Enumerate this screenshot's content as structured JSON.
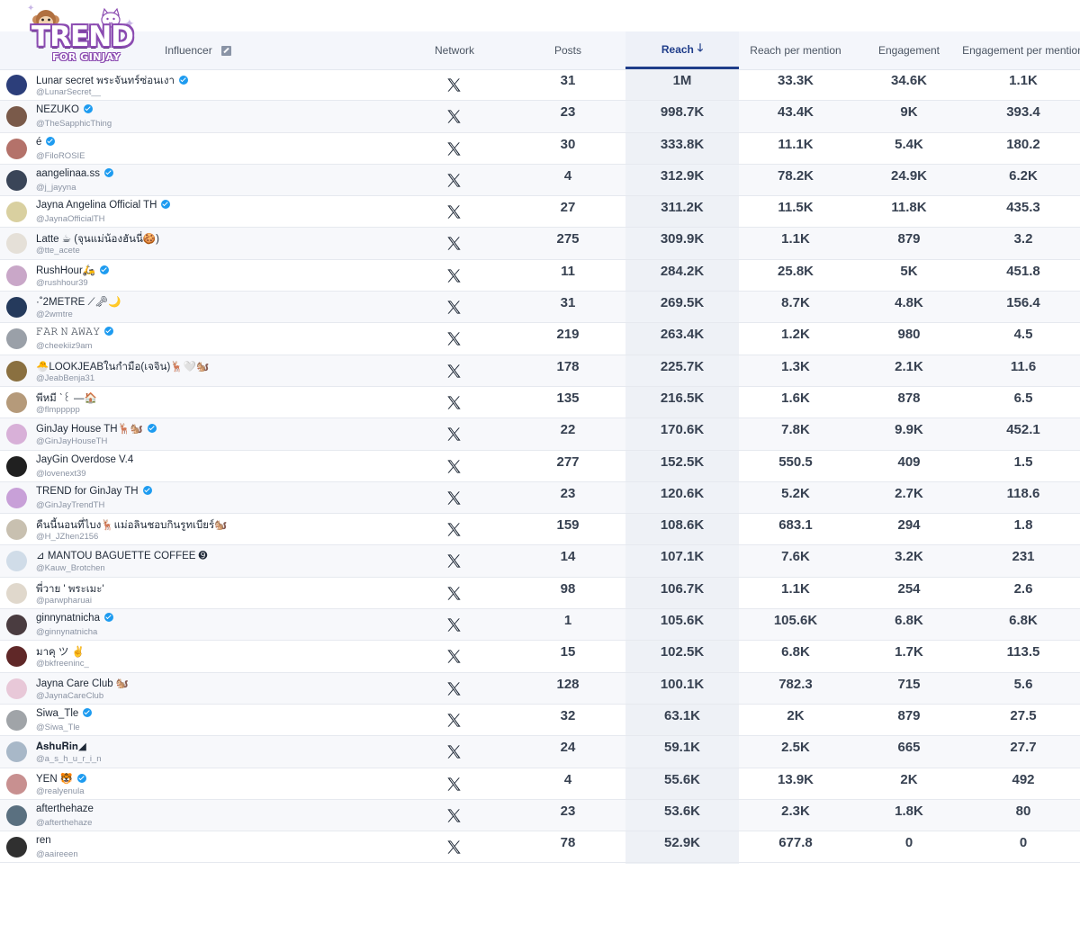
{
  "logo": {
    "word": "TREND",
    "sub": "FOR GINJAY"
  },
  "header": {
    "influencer": "Influencer",
    "network": "Network",
    "posts": "Posts",
    "reach": "Reach",
    "reach_per_mention": "Reach per mention",
    "engagement": "Engagement",
    "engagement_per_mention": "Engagement per mention",
    "sort_icon": "arrow-down-icon",
    "influencer_icon": "external-link-icon"
  },
  "colors": {
    "accent": "#1f3d8a",
    "verified": "#1d9bf0"
  },
  "rows": [
    {
      "name": "Lunar secret พระจันทร์ซ่อนเงา",
      "handle": "@LunarSecret__",
      "verified": true,
      "posts": "31",
      "reach": "1M",
      "rpm": "33.3K",
      "eng": "34.6K",
      "epm": "1.1K",
      "avatar": "#2c3e7a"
    },
    {
      "name": "NEZUKO",
      "handle": "@TheSapphicThing",
      "verified": true,
      "posts": "23",
      "reach": "998.7K",
      "rpm": "43.4K",
      "eng": "9K",
      "epm": "393.4",
      "avatar": "#7a5a4a"
    },
    {
      "name": "é",
      "handle": "@FiloROSIE",
      "verified": true,
      "posts": "30",
      "reach": "333.8K",
      "rpm": "11.1K",
      "eng": "5.4K",
      "epm": "180.2",
      "avatar": "#b4726a"
    },
    {
      "name": "aangelinaa.ss",
      "handle": "@j_jayyna",
      "verified": true,
      "posts": "4",
      "reach": "312.9K",
      "rpm": "78.2K",
      "eng": "24.9K",
      "epm": "6.2K",
      "avatar": "#3a4558"
    },
    {
      "name": "Jayna Angelina Official TH",
      "handle": "@JaynaOfficialTH",
      "verified": true,
      "posts": "27",
      "reach": "311.2K",
      "rpm": "11.5K",
      "eng": "11.8K",
      "epm": "435.3",
      "avatar": "#d9d0a0"
    },
    {
      "name": "Latte ☕ (จุนแม่น้องฮันนี่🍪)",
      "handle": "@tte_acete",
      "verified": false,
      "posts": "275",
      "reach": "309.9K",
      "rpm": "1.1K",
      "eng": "879",
      "epm": "3.2",
      "avatar": "#e5e0d8"
    },
    {
      "name": "RushHour🛵",
      "handle": "@rushhour39",
      "verified": true,
      "posts": "11",
      "reach": "284.2K",
      "rpm": "25.8K",
      "eng": "5K",
      "epm": "451.8",
      "avatar": "#c9a7c8"
    },
    {
      "name": "·˚2METRE ⟋🗝🌙",
      "handle": "@2wmtre",
      "verified": false,
      "posts": "31",
      "reach": "269.5K",
      "rpm": "8.7K",
      "eng": "4.8K",
      "epm": "156.4",
      "avatar": "#253a5c"
    },
    {
      "name": "𝙵𝙰𝚁 𝙽 𝙰𝚆𝙰𝚈",
      "handle": "@cheekiiz9am",
      "verified": true,
      "posts": "219",
      "reach": "263.4K",
      "rpm": "1.2K",
      "eng": "980",
      "epm": "4.5",
      "avatar": "#9aa0a8"
    },
    {
      "name": "🐣LOOKJEABในกำมือ(เจจิน)🦌🤍🐿️",
      "handle": "@JeabBenja31",
      "verified": false,
      "posts": "178",
      "reach": "225.7K",
      "rpm": "1.3K",
      "eng": "2.1K",
      "epm": "11.6",
      "avatar": "#8a7040"
    },
    {
      "name": "พีหมี ˋ꒰ —🏠",
      "handle": "@flmppppp",
      "verified": false,
      "posts": "135",
      "reach": "216.5K",
      "rpm": "1.6K",
      "eng": "878",
      "epm": "6.5",
      "avatar": "#b59a7a"
    },
    {
      "name": "GinJay House TH🦌🐿️",
      "handle": "@GinJayHouseTH",
      "verified": true,
      "posts": "22",
      "reach": "170.6K",
      "rpm": "7.8K",
      "eng": "9.9K",
      "epm": "452.1",
      "avatar": "#d8b0d8"
    },
    {
      "name": "JayGin Overdose V.4",
      "handle": "@lovenext39",
      "verified": false,
      "posts": "277",
      "reach": "152.5K",
      "rpm": "550.5",
      "eng": "409",
      "epm": "1.5",
      "avatar": "#202020"
    },
    {
      "name": "TREND for GinJay TH",
      "handle": "@GinJayTrendTH",
      "verified": true,
      "posts": "23",
      "reach": "120.6K",
      "rpm": "5.2K",
      "eng": "2.7K",
      "epm": "118.6",
      "avatar": "#c8a0d8"
    },
    {
      "name": "คืนนี้นอนที่ไบง🦌แม่อลินชอบกินรูทเบียร์🐿️",
      "handle": "@H_JZhen2156",
      "verified": false,
      "posts": "159",
      "reach": "108.6K",
      "rpm": "683.1",
      "eng": "294",
      "epm": "1.8",
      "avatar": "#c8c0b0"
    },
    {
      "name": "⊿ MANTOU BAGUETTE COFFEE ➒",
      "handle": "@Kauw_Brotchen",
      "verified": false,
      "posts": "14",
      "reach": "107.1K",
      "rpm": "7.6K",
      "eng": "3.2K",
      "epm": "231",
      "avatar": "#d0dce8"
    },
    {
      "name": "พี่วาย ' พระเมะ'",
      "handle": "@parwpharuai",
      "verified": false,
      "posts": "98",
      "reach": "106.7K",
      "rpm": "1.1K",
      "eng": "254",
      "epm": "2.6",
      "avatar": "#e0d8cc"
    },
    {
      "name": "ginnynatnicha",
      "handle": "@ginnynatnicha",
      "verified": true,
      "posts": "1",
      "reach": "105.6K",
      "rpm": "105.6K",
      "eng": "6.8K",
      "epm": "6.8K",
      "avatar": "#4a3c40"
    },
    {
      "name": "มาคุ ツ ✌️",
      "handle": "@bkfreeninc_",
      "verified": false,
      "posts": "15",
      "reach": "102.5K",
      "rpm": "6.8K",
      "eng": "1.7K",
      "epm": "113.5",
      "avatar": "#602828"
    },
    {
      "name": "Jayna Care Club 🐿️",
      "handle": "@JaynaCareClub",
      "verified": false,
      "posts": "128",
      "reach": "100.1K",
      "rpm": "782.3",
      "eng": "715",
      "epm": "5.6",
      "avatar": "#e8c8d8"
    },
    {
      "name": "Siwa_Tle",
      "handle": "@Siwa_Tle",
      "verified": true,
      "posts": "32",
      "reach": "63.1K",
      "rpm": "2K",
      "eng": "879",
      "epm": "27.5",
      "avatar": "#a0a4a8"
    },
    {
      "name": "𝐀𝐬𝐡𝐮𝐑𝐢𝐧◢",
      "handle": "@a_s_h_u_r_i_n",
      "verified": false,
      "posts": "24",
      "reach": "59.1K",
      "rpm": "2.5K",
      "eng": "665",
      "epm": "27.7",
      "avatar": "#a8b8c8"
    },
    {
      "name": "YEN 🐯",
      "handle": "@realyenula",
      "verified": true,
      "posts": "4",
      "reach": "55.6K",
      "rpm": "13.9K",
      "eng": "2K",
      "epm": "492",
      "avatar": "#c89090"
    },
    {
      "name": "afterthehaze",
      "handle": "@afterthehaze",
      "verified": false,
      "posts": "23",
      "reach": "53.6K",
      "rpm": "2.3K",
      "eng": "1.8K",
      "epm": "80",
      "avatar": "#5a7080"
    },
    {
      "name": "ren",
      "handle": "@aaireeen",
      "verified": false,
      "posts": "78",
      "reach": "52.9K",
      "rpm": "677.8",
      "eng": "0",
      "epm": "0",
      "avatar": "#303030"
    }
  ]
}
